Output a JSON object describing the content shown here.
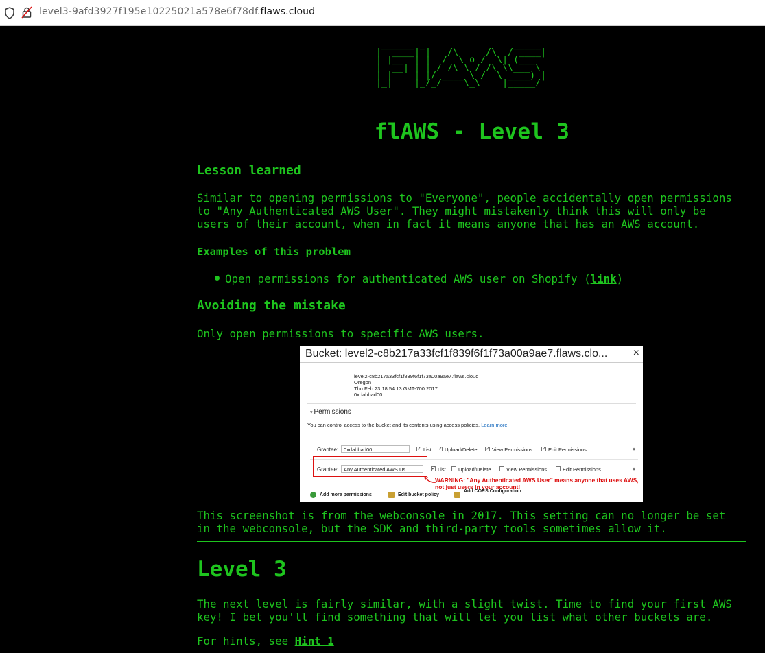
{
  "browser": {
    "url_prefix": "level3-9afd3927f195e10225021a578e6f78df.",
    "url_domain": "flaws.cloud"
  },
  "ascii_logo": " ______ _                   _____ \n |  ____| |    /\\  \\   /\\   / ____|\n | |__  | |   /  \\  \\ /  \\ / (___  \n |  __| | |  / /\\ \\  \\ /\\ / \\___ \\ \n | |    | |___/ ____ \\  \\ V /  ____) |\n |_|    |______/    \\_\\  \\/  |_____/ ",
  "title": "flAWS - Level 3",
  "lesson": {
    "heading": "Lesson learned",
    "text": "Similar to opening permissions to \"Everyone\", people accidentally open permissions\nto \"Any Authenticated AWS User\". They might mistakenly think this will only be\nusers of their account, when in fact it means anyone that has an AWS account.",
    "examples_heading": "Examples of this problem",
    "examples": [
      {
        "text": "Open permissions for authenticated AWS user on Shopify (",
        "link": "link",
        "suffix": ")"
      }
    ]
  },
  "avoiding": {
    "heading": "Avoiding the mistake",
    "text": "Only open permissions to specific AWS users."
  },
  "aws_console": {
    "title": "Bucket: level2-c8b217a33fcf1f839f6f1f73a00a9ae7.flaws.clo...",
    "close": "×",
    "meta": [
      {
        "key": "Bucket:",
        "value": "level2-c8b217a33fcf1f839f6f1f73a00a9ae7.flaws.cloud"
      },
      {
        "key": "Region:",
        "value": "Oregon"
      },
      {
        "key": "Creation Date:",
        "value": "Thu Feb 23 18:54:13 GMT-700 2017"
      },
      {
        "key": "Owner:",
        "value": "0xdabbad00"
      }
    ],
    "permissions_label": "Permissions",
    "permissions_desc": "You can control access to the bucket and its contents using access policies.",
    "learn_more": "Learn more.",
    "grantee_label": "Grantee:",
    "rows": [
      {
        "grantee": "0xdabbad00",
        "list": true,
        "upload": true,
        "view": true,
        "edit": true
      },
      {
        "grantee": "Any Authenticated AWS Us",
        "list": true,
        "upload": false,
        "view": false,
        "edit": false
      }
    ],
    "perm_labels": {
      "list": "List",
      "upload": "Upload/Delete",
      "view": "View Permissions",
      "edit": "Edit Permissions"
    },
    "row_remove": "x",
    "warning": "WARNING: \"Any Authenticated AWS User\" means anyone that uses AWS, not just users in your account!",
    "footer": {
      "add": "Add more permissions",
      "policy": "Edit bucket policy",
      "cors": "Add CORS Configuration"
    }
  },
  "screenshot_note": "This screenshot is from the webconsole in 2017. This setting can no longer be set\nin the webconsole, but the SDK and third-party tools sometimes allow it.",
  "level": {
    "heading": "Level 3",
    "text": "The next level is fairly similar, with a slight twist. Time to find your first AWS\nkey! I bet you'll find something that will let you list what other buckets are.",
    "hints_prefix": "For hints, see ",
    "hint_link": "Hint 1"
  },
  "colors": {
    "text": "#1ec41e",
    "background": "#000000",
    "warning": "#dd1111"
  }
}
